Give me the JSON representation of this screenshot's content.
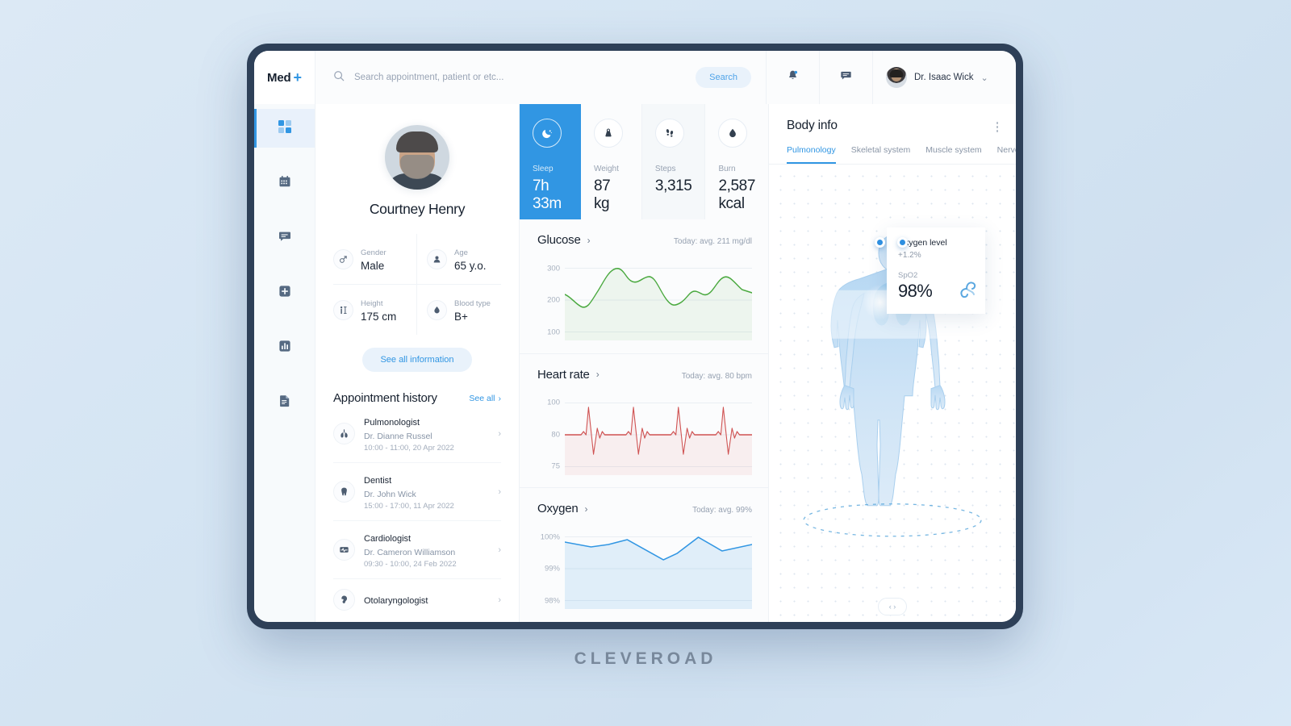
{
  "brand": {
    "footer": "CLEVEROAD"
  },
  "topbar": {
    "logo_text": "Med",
    "logo_plus": "+",
    "search_placeholder": "Search appointment, patient or etc...",
    "search_value": "",
    "search_button": "Search",
    "notifications_icon": "bell-icon",
    "messages_icon": "chat-icon",
    "user_name": "Dr. Isaac Wick",
    "user_chevron": "⌄"
  },
  "sidebar": {
    "items": [
      {
        "icon": "dashboard-icon",
        "active": true
      },
      {
        "icon": "calendar-icon",
        "active": false
      },
      {
        "icon": "chat-icon",
        "active": false
      },
      {
        "icon": "add-icon",
        "active": false
      },
      {
        "icon": "stats-icon",
        "active": false
      },
      {
        "icon": "document-icon",
        "active": false
      }
    ]
  },
  "patient": {
    "name": "Courtney Henry",
    "info": [
      {
        "label": "Gender",
        "value": "Male",
        "icon": "gender-icon"
      },
      {
        "label": "Age",
        "value": "65 y.o.",
        "icon": "person-icon"
      },
      {
        "label": "Height",
        "value": "175 cm",
        "icon": "height-icon"
      },
      {
        "label": "Blood type",
        "value": "B+",
        "icon": "blood-drop-icon"
      }
    ],
    "see_all_information": "See all information"
  },
  "appointments": {
    "title": "Appointment history",
    "see_all": "See all",
    "items": [
      {
        "specialty": "Pulmonologist",
        "doctor": "Dr. Dianne Russel",
        "time": "10:00 - 11:00, 20 Apr 2022",
        "icon": "lungs-icon"
      },
      {
        "specialty": "Dentist",
        "doctor": "Dr. John Wick",
        "time": "15:00 - 17:00, 11 Apr 2022",
        "icon": "tooth-icon"
      },
      {
        "specialty": "Cardiologist",
        "doctor": "Dr. Cameron Williamson",
        "time": "09:30 - 10:00, 24 Feb 2022",
        "icon": "ecg-icon"
      },
      {
        "specialty": "Otolaryngologist",
        "doctor": "",
        "time": "",
        "icon": "ear-icon"
      }
    ]
  },
  "stats": [
    {
      "label": "Sleep",
      "value": "7h 33m",
      "icon": "moon-icon",
      "active": true
    },
    {
      "label": "Weight",
      "value": "87 kg",
      "icon": "weight-icon",
      "active": false
    },
    {
      "label": "Steps",
      "value": "3,315",
      "icon": "footsteps-icon",
      "active": false
    },
    {
      "label": "Burn",
      "value": "2,587 kcal",
      "icon": "flame-icon",
      "active": false
    }
  ],
  "charts": {
    "glucose": {
      "title": "Glucose",
      "subtitle": "Today: avg. 211 mg/dl",
      "ticks": [
        "300",
        "200",
        "100"
      ],
      "accent": "#4aa93f"
    },
    "heart_rate": {
      "title": "Heart rate",
      "subtitle": "Today: avg. 80 bpm",
      "ticks": [
        "100",
        "80",
        "75"
      ],
      "accent": "#d35050"
    },
    "oxygen": {
      "title": "Oxygen",
      "subtitle": "Today: avg. 99%",
      "ticks": [
        "100%",
        "99%",
        "98%"
      ],
      "accent": "#3196e3"
    }
  },
  "chart_data": [
    {
      "type": "area",
      "title": "Glucose",
      "subtitle": "Today: avg. 211 mg/dl",
      "ylabel": "mg/dl",
      "xlabel": "",
      "ylim": [
        100,
        330
      ],
      "yticks": [
        300,
        200,
        100
      ],
      "grid": true,
      "legend": "none",
      "color": "#4aa93f",
      "x": [
        0,
        1,
        2,
        3,
        4,
        5,
        6,
        7,
        8,
        9,
        10,
        11,
        12,
        13,
        14,
        15,
        16
      ],
      "values": [
        218,
        200,
        176,
        200,
        260,
        294,
        272,
        252,
        265,
        258,
        215,
        182,
        192,
        219,
        210,
        262,
        225
      ]
    },
    {
      "type": "line",
      "title": "Heart rate",
      "subtitle": "Today: avg. 80 bpm",
      "ylabel": "bpm",
      "xlabel": "",
      "ylim": [
        72,
        102
      ],
      "yticks": [
        100,
        80,
        75
      ],
      "grid": true,
      "legend": "none",
      "color": "#d35050",
      "note": "ECG waveform, 4 repeating beats, baseline 80 bpm, peaks ~96, troughs ~76",
      "x": [
        0,
        1,
        2,
        3,
        4,
        5,
        6,
        7,
        8,
        9,
        10,
        11,
        12,
        13,
        14,
        15,
        16,
        17,
        18,
        19
      ],
      "values": [
        80,
        80,
        96,
        76,
        80,
        84,
        80,
        80,
        96,
        76,
        80,
        84,
        80,
        80,
        96,
        76,
        80,
        84,
        80,
        80
      ]
    },
    {
      "type": "area",
      "title": "Oxygen",
      "subtitle": "Today: avg. 99%",
      "ylabel": "%",
      "xlabel": "",
      "ylim": [
        98,
        100.2
      ],
      "yticks": [
        "100%",
        "99%",
        "98%"
      ],
      "grid": true,
      "legend": "none",
      "color": "#3196e3",
      "x": [
        0,
        1,
        2,
        3,
        4,
        5,
        6,
        7,
        8,
        9
      ],
      "values": [
        99.85,
        99.75,
        99.72,
        99.82,
        99.9,
        99.6,
        99.35,
        99.78,
        100.0,
        99.65
      ]
    }
  ],
  "body_info": {
    "title": "Body info",
    "menu_icon": "kebab-menu-icon",
    "tabs": [
      {
        "label": "Pulmonology",
        "active": true
      },
      {
        "label": "Skeletal system",
        "active": false
      },
      {
        "label": "Muscle system",
        "active": false
      },
      {
        "label": "Nervous system",
        "active": false
      }
    ],
    "tooltip": {
      "title": "Oxygen level",
      "delta": "+1.2%",
      "metric_label": "SpO2",
      "metric_value": "98%",
      "icon": "swirl-icon"
    },
    "rotate_control": "‹ ›"
  }
}
